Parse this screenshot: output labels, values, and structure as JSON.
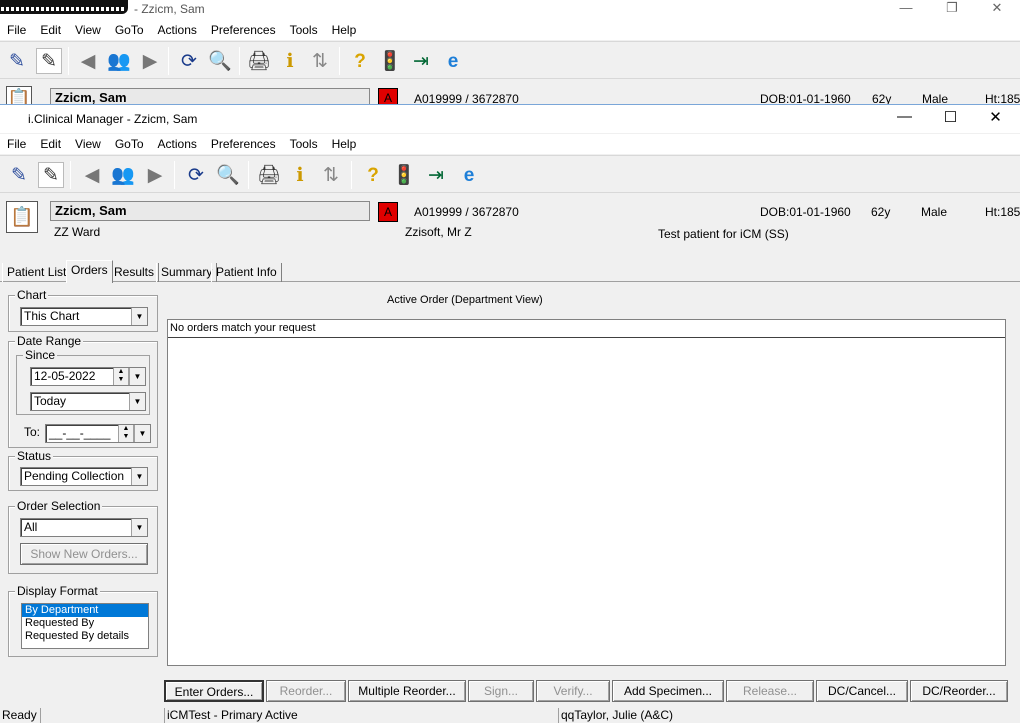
{
  "background_window": {
    "title": "- Zzicm, Sam",
    "menu": [
      "File",
      "Edit",
      "View",
      "GoTo",
      "Actions",
      "Preferences",
      "Tools",
      "Help"
    ],
    "patient_name": "Zzicm, Sam",
    "flag": "A",
    "id": "A019999 / 3672870",
    "dob": "DOB:01-01-1960",
    "age": "62y",
    "sex": "Male",
    "ht": "Ht:185"
  },
  "window": {
    "title": "i.Clinical Manager - Zzicm, Sam",
    "minimize": "—",
    "maximize": "☐",
    "close": "✕"
  },
  "menu": [
    "File",
    "Edit",
    "View",
    "GoTo",
    "Actions",
    "Preferences",
    "Tools",
    "Help"
  ],
  "patient": {
    "name": "Zzicm, Sam",
    "flag": "A",
    "id": "A019999 / 3672870",
    "dob": "DOB:01-01-1960",
    "age": "62y",
    "sex": "Male",
    "ht": "Ht:185",
    "ward": "ZZ Ward",
    "consultant": "Zzisoft, Mr Z",
    "note": "Test patient for iCM (SS)"
  },
  "tabs": [
    "Patient List",
    "Orders",
    "Results",
    "Summary",
    "Patient Info"
  ],
  "filters": {
    "chart_label": "Chart",
    "chart_value": "This Chart",
    "date_range_label": "Date Range",
    "since_label": "Since",
    "since_date": "12-05-2022",
    "since_period": "Today",
    "to_label": "To:",
    "to_value": "__-__-____",
    "status_label": "Status",
    "status_value": "Pending Collection",
    "order_selection_label": "Order Selection",
    "order_selection_value": "All",
    "show_new_orders": "Show New Orders...",
    "display_format_label": "Display Format",
    "display_formats": [
      "By Department",
      "Requested By",
      "Requested By details"
    ],
    "display_format_selected": "By Department"
  },
  "orders": {
    "heading": "Active Order (Department View)",
    "empty_message": "No orders match your request"
  },
  "buttons": [
    "Enter Orders...",
    "Reorder...",
    "Multiple Reorder...",
    "Sign...",
    "Verify...",
    "Add Specimen...",
    "Release...",
    "DC/Cancel...",
    "DC/Reorder..."
  ],
  "status_bar": {
    "state": "Ready",
    "environment": "iCMTest - Primary Active",
    "user": "qqTaylor, Julie  (A&C)"
  }
}
